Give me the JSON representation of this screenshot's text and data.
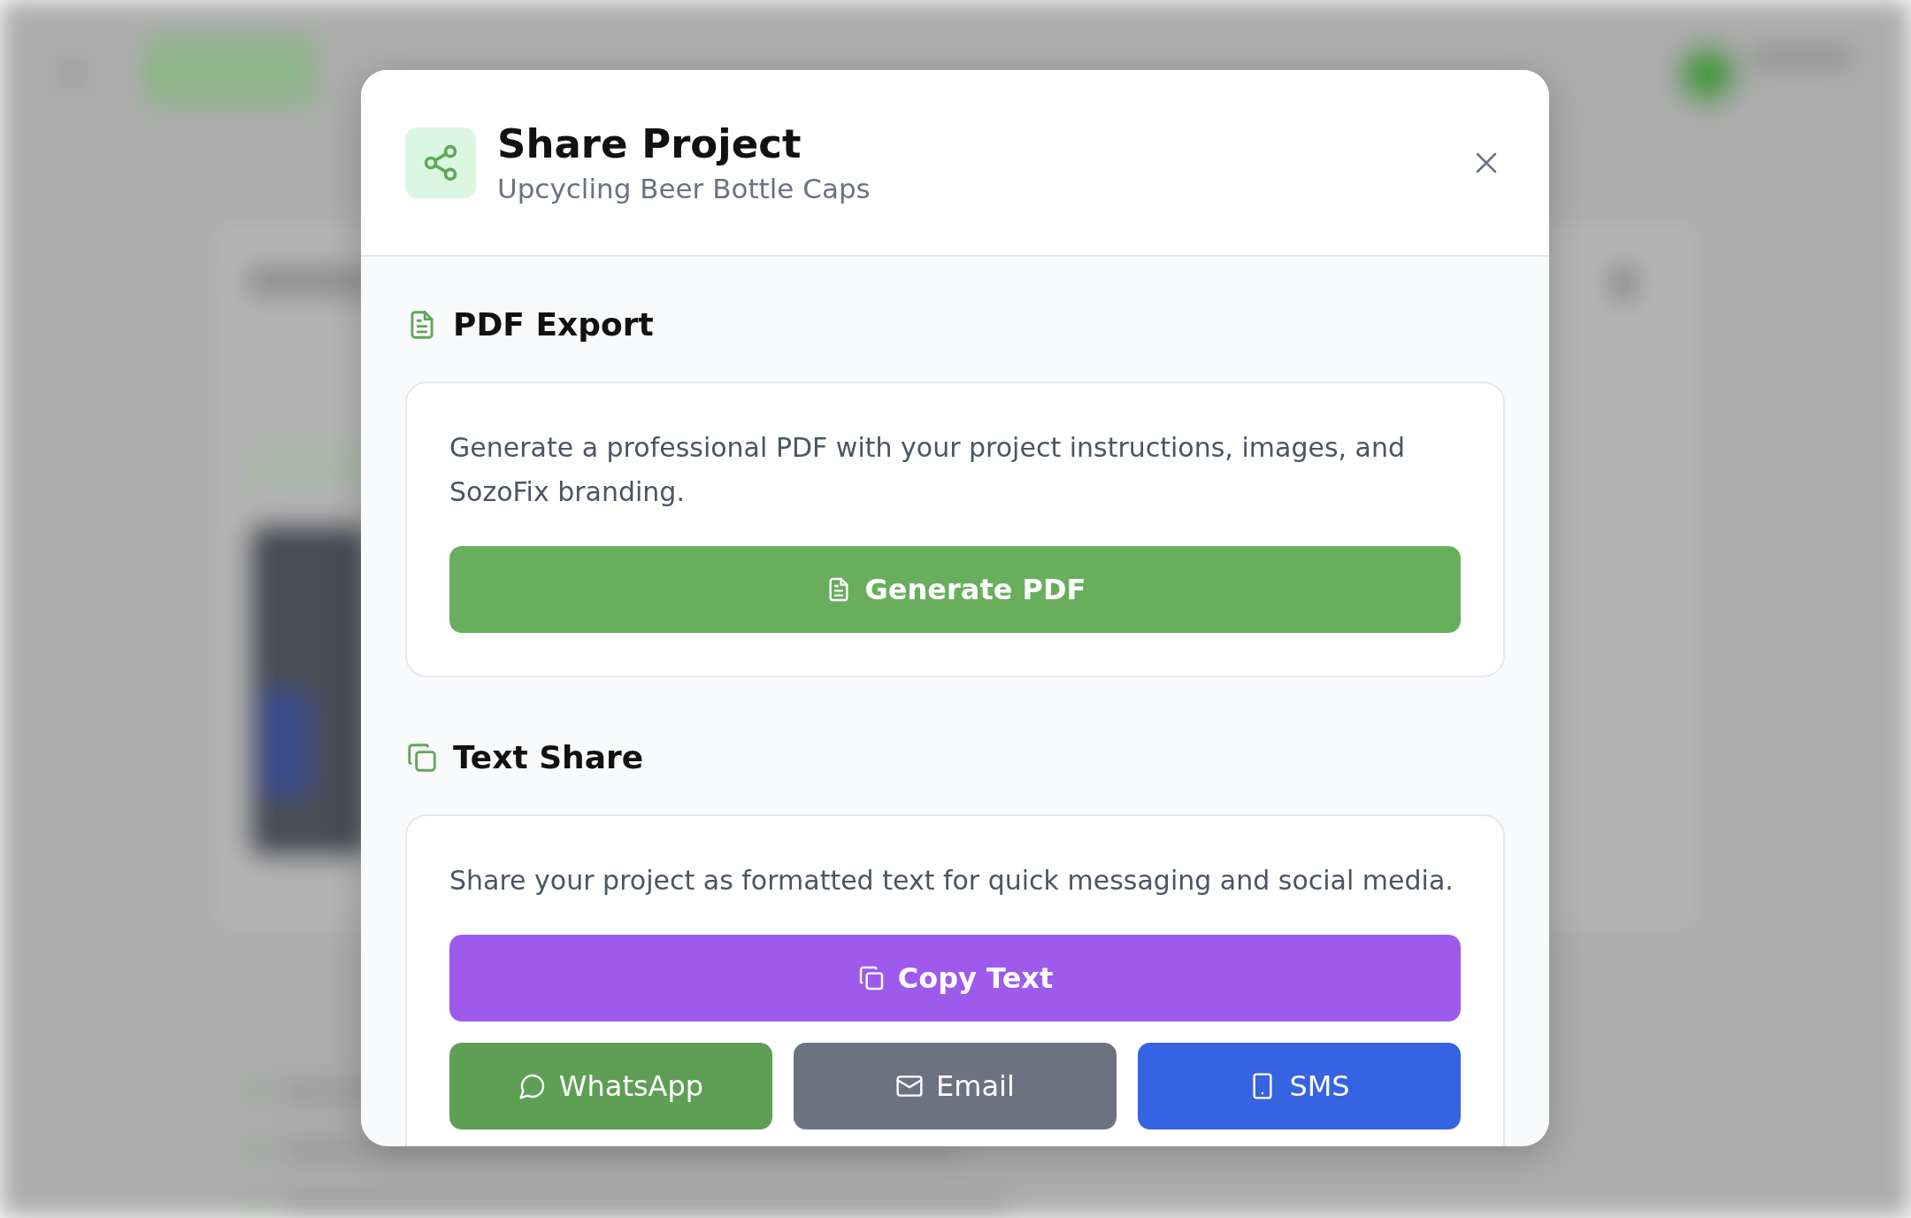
{
  "dialog": {
    "title": "Share Project",
    "subtitle": "Upcycling Beer Bottle Caps",
    "sections": [
      {
        "kind": "pdf",
        "heading": "PDF Export",
        "description": "Generate a professional PDF with your project instructions, images, and SozoFix branding.",
        "primary_button": {
          "label": "Generate PDF",
          "color": "#68ae5d"
        }
      },
      {
        "kind": "text",
        "heading": "Text Share",
        "description": "Share your project as formatted text for quick messaging and social media.",
        "primary_button": {
          "label": "Copy Text",
          "color": "#9d5aec"
        },
        "channels": [
          {
            "kind": "chat",
            "label": "WhatsApp",
            "color": "#5e9f55"
          },
          {
            "kind": "mail",
            "label": "Email",
            "color": "#6b7280"
          },
          {
            "kind": "phone",
            "label": "SMS",
            "color": "#3663e1"
          }
        ]
      }
    ]
  }
}
